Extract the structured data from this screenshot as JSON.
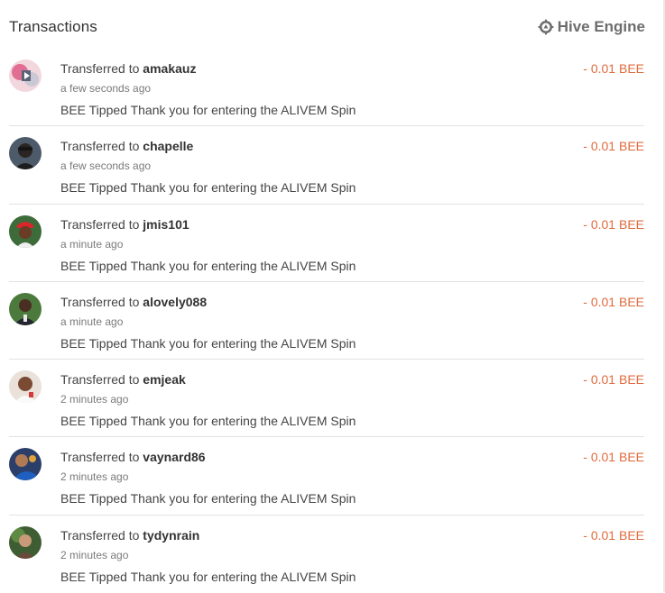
{
  "header": {
    "title": "Transactions",
    "engine_label": "Hive Engine",
    "engine_icon": "hive-engine-gear-icon"
  },
  "colors": {
    "amount": "#e06a3c",
    "text": "#454545",
    "muted": "#7a7a7a"
  },
  "transactions": [
    {
      "prefix": "Transferred to",
      "user": "amakauz",
      "time": "a few seconds ago",
      "memo": "BEE Tipped Thank you for entering the ALIVEM Spin",
      "amount": "- 0.01 BEE",
      "avatar": "avatar-pink"
    },
    {
      "prefix": "Transferred to",
      "user": "chapelle",
      "time": "a few seconds ago",
      "memo": "BEE Tipped Thank you for entering the ALIVEM Spin",
      "amount": "- 0.01 BEE",
      "avatar": "avatar-dark"
    },
    {
      "prefix": "Transferred to",
      "user": "jmis101",
      "time": "a minute ago",
      "memo": "BEE Tipped Thank you for entering the ALIVEM Spin",
      "amount": "- 0.01 BEE",
      "avatar": "avatar-red-hat"
    },
    {
      "prefix": "Transferred to",
      "user": "alovely088",
      "time": "a minute ago",
      "memo": "BEE Tipped Thank you for entering the ALIVEM Spin",
      "amount": "- 0.01 BEE",
      "avatar": "avatar-green"
    },
    {
      "prefix": "Transferred to",
      "user": "emjeak",
      "time": "2 minutes ago",
      "memo": "BEE Tipped Thank you for entering the ALIVEM Spin",
      "amount": "- 0.01 BEE",
      "avatar": "avatar-light"
    },
    {
      "prefix": "Transferred to",
      "user": "vaynard86",
      "time": "2 minutes ago",
      "memo": "BEE Tipped Thank you for entering the ALIVEM Spin",
      "amount": "- 0.01 BEE",
      "avatar": "avatar-blue"
    },
    {
      "prefix": "Transferred to",
      "user": "tydynrain",
      "time": "2 minutes ago",
      "memo": "BEE Tipped Thank you for entering the ALIVEM Spin",
      "amount": "- 0.01 BEE",
      "avatar": "avatar-forest"
    }
  ]
}
